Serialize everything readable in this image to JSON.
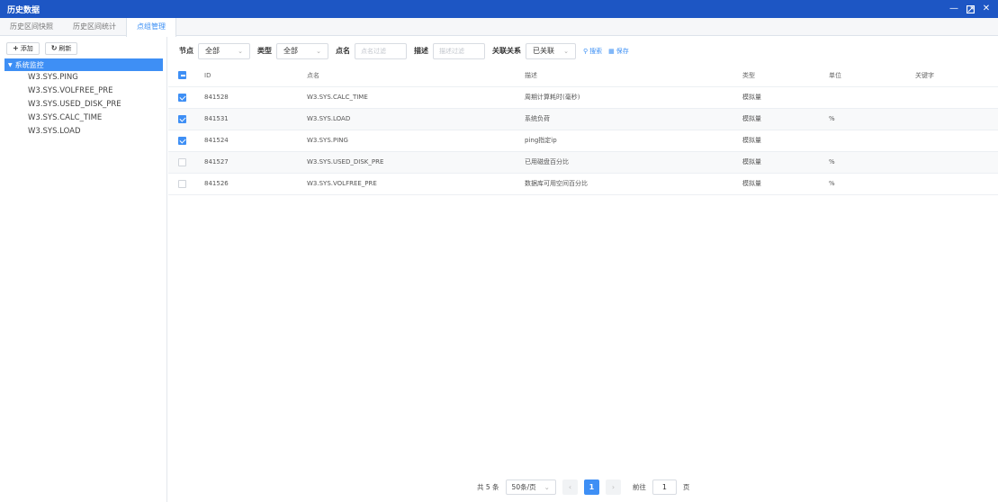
{
  "window": {
    "title": "历史数据"
  },
  "tabs": [
    {
      "label": "历史区间快照"
    },
    {
      "label": "历史区间统计"
    },
    {
      "label": "点组管理"
    }
  ],
  "sidebar": {
    "add_label": "添加",
    "refresh_label": "刷新",
    "root_label": "系统监控",
    "items": [
      {
        "label": "W3.SYS.PING"
      },
      {
        "label": "W3.SYS.VOLFREE_PRE"
      },
      {
        "label": "W3.SYS.USED_DISK_PRE"
      },
      {
        "label": "W3.SYS.CALC_TIME"
      },
      {
        "label": "W3.SYS.LOAD"
      }
    ]
  },
  "filters": {
    "node_label": "节点",
    "node_value": "全部",
    "type_label": "类型",
    "type_value": "全部",
    "name_label": "点名",
    "name_placeholder": "点名过滤",
    "desc_label": "描述",
    "desc_placeholder": "描述过滤",
    "relation_label": "关联关系",
    "relation_value": "已关联",
    "search_label": "搜索",
    "save_label": "保存"
  },
  "table": {
    "columns": [
      "ID",
      "点名",
      "描述",
      "类型",
      "单位",
      "关键字"
    ],
    "rows": [
      {
        "checked": true,
        "id": "841528",
        "name": "W3.SYS.CALC_TIME",
        "desc": "周期计算耗时(毫秒)",
        "type": "模拟量",
        "unit": "",
        "keyword": ""
      },
      {
        "checked": true,
        "id": "841531",
        "name": "W3.SYS.LOAD",
        "desc": "系统负荷",
        "type": "模拟量",
        "unit": "%",
        "keyword": ""
      },
      {
        "checked": true,
        "id": "841524",
        "name": "W3.SYS.PING",
        "desc": "ping指定ip",
        "type": "模拟量",
        "unit": "",
        "keyword": ""
      },
      {
        "checked": false,
        "id": "841527",
        "name": "W3.SYS.USED_DISK_PRE",
        "desc": "已用磁盘百分比",
        "type": "模拟量",
        "unit": "%",
        "keyword": ""
      },
      {
        "checked": false,
        "id": "841526",
        "name": "W3.SYS.VOLFREE_PRE",
        "desc": "数据库可用空间百分比",
        "type": "模拟量",
        "unit": "%",
        "keyword": ""
      }
    ]
  },
  "pager": {
    "total_text": "共 5 条",
    "page_size": "50条/页",
    "current_page": "1",
    "goto_label": "前往",
    "goto_value": "1",
    "page_suffix": "页"
  },
  "colors": {
    "titlebar": "#1d56c4",
    "accent": "#3e8ff5"
  }
}
